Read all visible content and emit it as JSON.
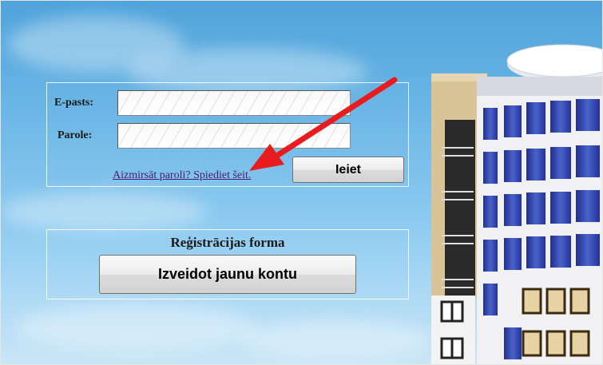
{
  "login": {
    "email_label": "E-pasts:",
    "email_value": "",
    "password_label": "Parole:",
    "password_value": "",
    "forgot_link": "Aizmirsāt paroli? Spiediet šeit.",
    "login_button": "Ieiet"
  },
  "registration": {
    "title": "Reģistrācijas forma",
    "create_button": "Izveidot jaunu kontu"
  },
  "colors": {
    "arrow": "#e81c1c",
    "link": "#4a1a6b",
    "sky_top": "#4fa3db",
    "sky_bottom": "#c9e6f7"
  }
}
